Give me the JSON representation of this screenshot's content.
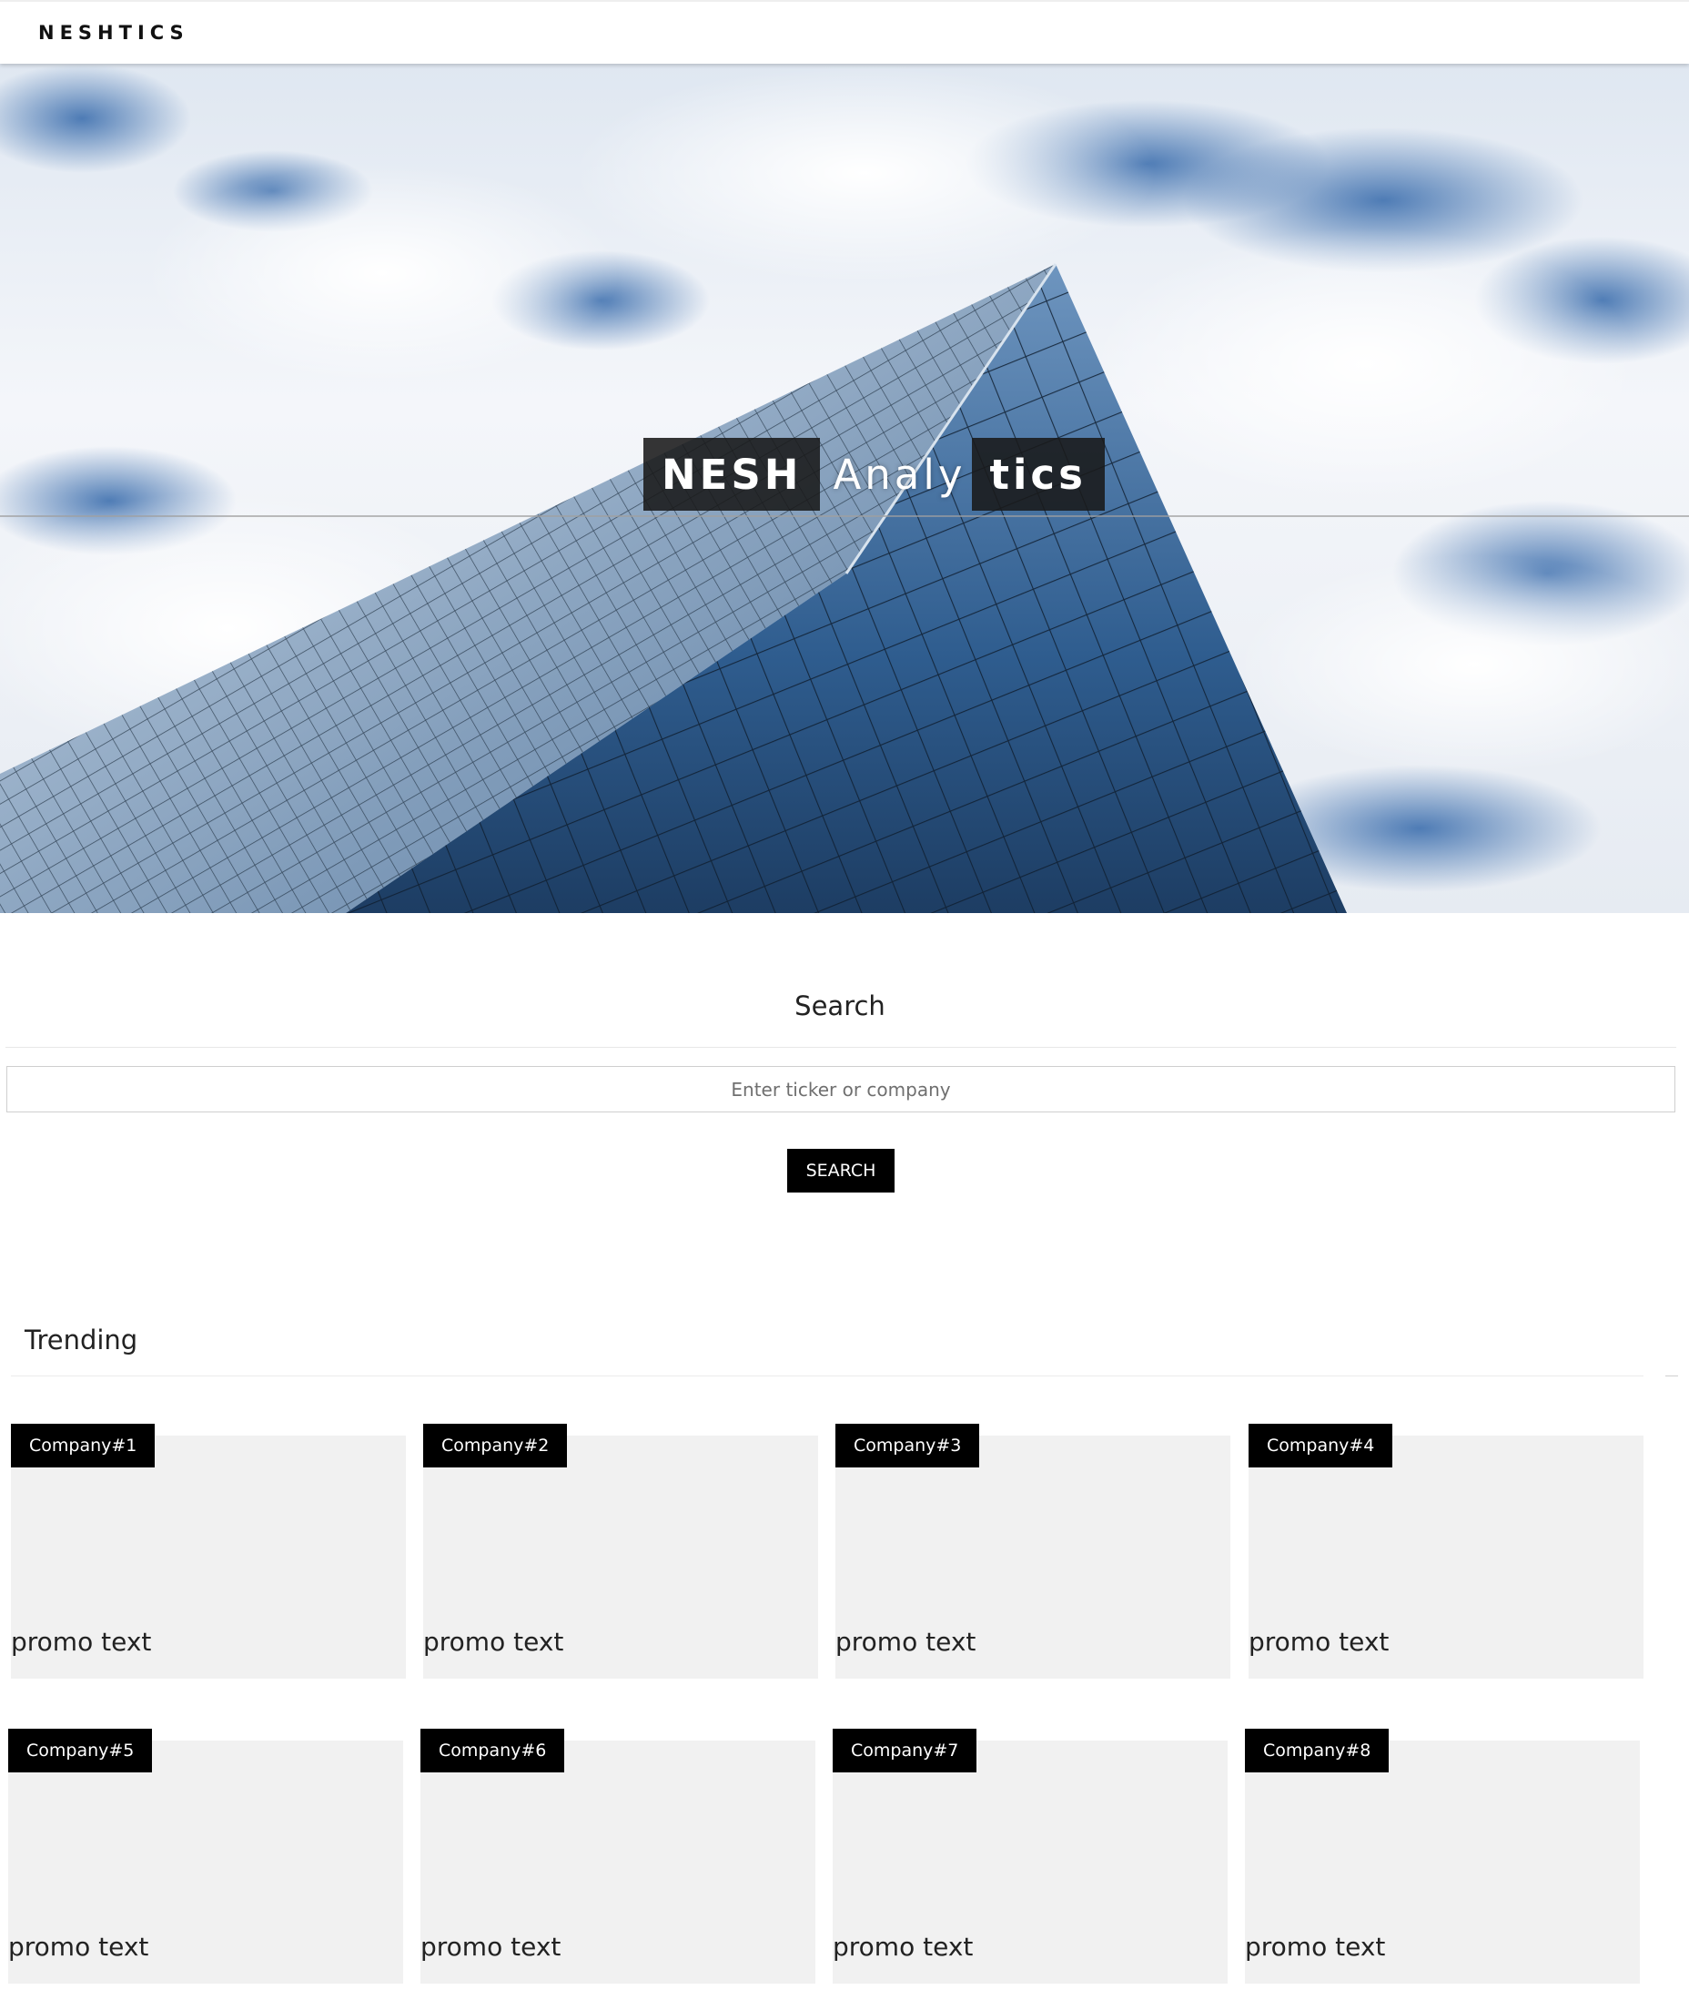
{
  "navbar": {
    "brand": "NESHTICS"
  },
  "hero": {
    "title_parts": [
      "NESH",
      "Analy",
      "tics"
    ]
  },
  "search": {
    "heading": "Search",
    "placeholder": "Enter ticker or company",
    "value": "",
    "button_label": "SEARCH"
  },
  "trending": {
    "heading": "Trending",
    "cards": [
      {
        "name": "Company#1",
        "text": "promo text"
      },
      {
        "name": "Company#2",
        "text": "promo text"
      },
      {
        "name": "Company#3",
        "text": "promo text"
      },
      {
        "name": "Company#4",
        "text": "promo text"
      },
      {
        "name": "Company#5",
        "text": "promo text"
      },
      {
        "name": "Company#6",
        "text": "promo text"
      },
      {
        "name": "Company#7",
        "text": "promo text"
      },
      {
        "name": "Company#8",
        "text": "promo text"
      }
    ]
  },
  "colors": {
    "badge_bg": "#000000",
    "card_bg": "#f1f1f1",
    "hero_box_bg": "#191919",
    "sky_blue": "#3d6fae",
    "glass_blue": "#2f5d8f"
  }
}
